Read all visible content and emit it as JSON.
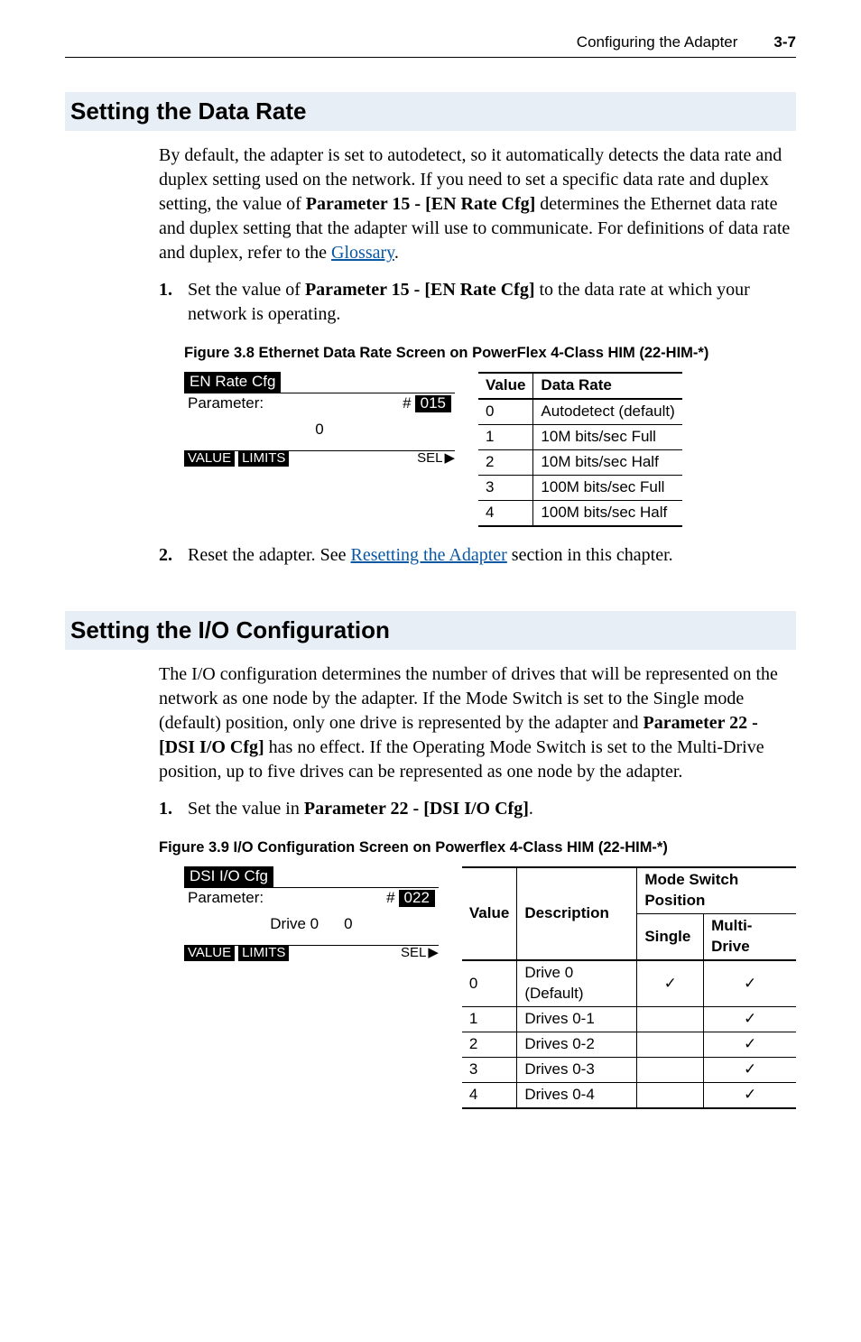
{
  "header": {
    "chapter": "Configuring the Adapter",
    "page": "3-7"
  },
  "section1": {
    "title": "Setting the Data Rate",
    "para1_pre": "By default, the adapter is set to autodetect, so it automatically detects the data rate and duplex setting used on the network. If you need to set a specific data rate and duplex setting, the value of ",
    "para1_bold": "Parameter 15 - [EN Rate Cfg]",
    "para1_post": " determines the Ethernet data rate and duplex setting that the adapter will use to communicate. For definitions of data rate and duplex, refer to the ",
    "para1_link": "Glossary",
    "para1_end": ".",
    "step1_num": "1.",
    "step1_pre": "Set the value of ",
    "step1_bold": "Parameter 15 - [EN Rate Cfg]",
    "step1_post": " to the data rate at which your network is operating.",
    "fig_caption": "Figure 3.8   Ethernet Data Rate Screen on PowerFlex 4-Class HIM (22-HIM-*)",
    "him": {
      "title": "EN Rate Cfg",
      "param_label": "Parameter:",
      "hash": "#",
      "param_num": "015",
      "center_value": "0",
      "value_label": "VALUE",
      "limits_label": "LIMITS",
      "sel_label": "SEL",
      "sel_arrow": "▶"
    },
    "data_rate_table": {
      "head_value": "Value",
      "head_rate": "Data Rate",
      "rows": [
        {
          "v": "0",
          "d": "Autodetect (default)"
        },
        {
          "v": "1",
          "d": "10M bits/sec Full"
        },
        {
          "v": "2",
          "d": "10M bits/sec Half"
        },
        {
          "v": "3",
          "d": "100M bits/sec Full"
        },
        {
          "v": "4",
          "d": "100M bits/sec Half"
        }
      ]
    },
    "step2_num": "2.",
    "step2_pre": "Reset the adapter. See ",
    "step2_link": "Resetting the Adapter",
    "step2_post": " section in this chapter."
  },
  "section2": {
    "title": "Setting the I/O Configuration",
    "para1_a": "The I/O configuration determines the number of drives that will be represented on the network as one node by the adapter. If the Mode Switch is set to the Single mode (default) position, only one drive is represented by the adapter and ",
    "para1_bold": "Parameter 22 - [DSI I/O Cfg]",
    "para1_b": " has no effect. If the Operating Mode Switch is set to the Multi-Drive position, up to five drives can be represented as one node by the adapter.",
    "step1_num": "1.",
    "step1_pre": "Set the value in ",
    "step1_bold": "Parameter 22 - [DSI I/O Cfg]",
    "step1_post": ".",
    "fig_caption": "Figure 3.9   I/O Configuration Screen on Powerflex 4-Class HIM (22-HIM-*)",
    "him": {
      "title": "DSI I/O Cfg",
      "param_label": "Parameter:",
      "hash": "#",
      "param_num": "022",
      "center_label": "Drive 0",
      "center_value": "0",
      "value_label": "VALUE",
      "limits_label": "LIMITS",
      "sel_label": "SEL",
      "sel_arrow": "▶"
    },
    "io_table": {
      "head_value": "Value",
      "head_desc": "Description",
      "head_mode": "Mode Switch Position",
      "head_single": "Single",
      "head_multi": "Multi-Drive",
      "rows": [
        {
          "v": "0",
          "d": "Drive 0 (Default)",
          "s": "✓",
          "m": "✓"
        },
        {
          "v": "1",
          "d": "Drives 0-1",
          "s": "",
          "m": "✓"
        },
        {
          "v": "2",
          "d": "Drives 0-2",
          "s": "",
          "m": "✓"
        },
        {
          "v": "3",
          "d": "Drives 0-3",
          "s": "",
          "m": "✓"
        },
        {
          "v": "4",
          "d": "Drives 0-4",
          "s": "",
          "m": "✓"
        }
      ]
    }
  },
  "chart_data": [
    {
      "type": "table",
      "title": "Ethernet Data Rate options",
      "columns": [
        "Value",
        "Data Rate"
      ],
      "rows": [
        [
          0,
          "Autodetect (default)"
        ],
        [
          1,
          "10M bits/sec Full"
        ],
        [
          2,
          "10M bits/sec Half"
        ],
        [
          3,
          "100M bits/sec Full"
        ],
        [
          4,
          "100M bits/sec Half"
        ]
      ]
    },
    {
      "type": "table",
      "title": "I/O Configuration options vs Mode Switch Position",
      "columns": [
        "Value",
        "Description",
        "Single",
        "Multi-Drive"
      ],
      "rows": [
        [
          0,
          "Drive 0 (Default)",
          true,
          true
        ],
        [
          1,
          "Drives 0-1",
          false,
          true
        ],
        [
          2,
          "Drives 0-2",
          false,
          true
        ],
        [
          3,
          "Drives 0-3",
          false,
          true
        ],
        [
          4,
          "Drives 0-4",
          false,
          true
        ]
      ]
    }
  ]
}
